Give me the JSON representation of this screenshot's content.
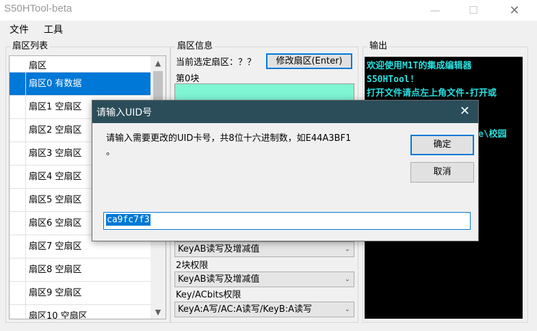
{
  "window": {
    "title": "S50HTool-beta",
    "min": "—",
    "max": "☐",
    "close": "✕"
  },
  "menu": [
    "文件",
    "工具"
  ],
  "sector_list": {
    "label": "扇区列表",
    "header": "扇区",
    "rows": [
      "扇区0 有数据",
      "扇区1 空扇区",
      "扇区2 空扇区",
      "扇区3 空扇区",
      "扇区4 空扇区",
      "扇区5 空扇区",
      "扇区6 空扇区",
      "扇区7 空扇区",
      "扇区8 空扇区",
      "扇区9 空扇区",
      "扇区10 空扇区"
    ],
    "selected": 0,
    "arrow_up": "▲",
    "arrow_down": "▼"
  },
  "sector_info": {
    "label": "扇区信息",
    "current": "当前选定扇区：？？",
    "modify_button": "修改扇区(Enter)",
    "block0": "第0块",
    "combo1": "KeyAB读写及增减值",
    "label_block2": "2块权限",
    "combo2": "KeyAB读写及增减值",
    "label_keybits": "Key/ACbits权限",
    "combo3": "KeyA:A写/AC:A读写/KeyB:A读写",
    "chevron": "⌄"
  },
  "output": {
    "label": "输出",
    "lines": [
      "欢迎使用M1T的集成编辑器",
      "S50HTool!",
      "打开文件请点左上角文件-打开或",
      "",
      "",
      "e\\校园"
    ]
  },
  "dialog": {
    "title": "请输入UID号",
    "close": "✕",
    "message_line1": "请输入需要更改的UID卡号，共8位十六进制数，如E44A3BF1",
    "message_line2": "。",
    "ok": "确定",
    "cancel": "取消",
    "input_value": "ca9fc7f3"
  }
}
